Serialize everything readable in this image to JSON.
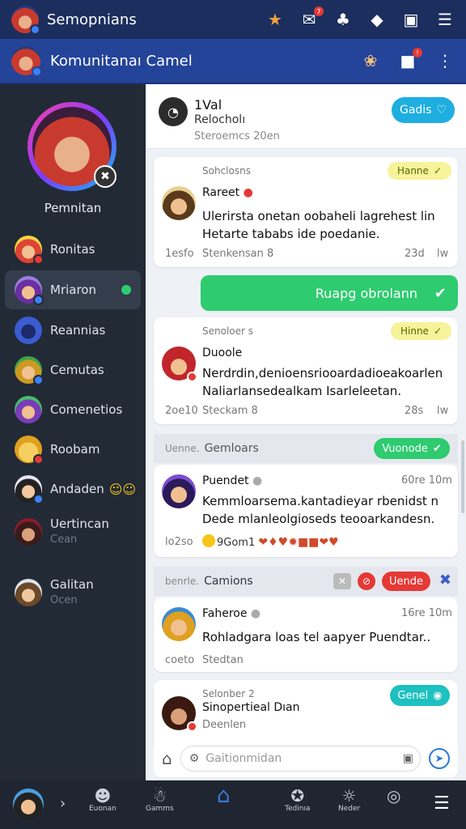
{
  "app": {
    "title": "Semopnians"
  },
  "community": {
    "title": "Komunitanaı Camel"
  },
  "sidebar": {
    "profile_name": "Pemnitan",
    "items": [
      {
        "label": "Ronitas",
        "sub": ""
      },
      {
        "label": "Mriaron",
        "sub": ""
      },
      {
        "label": "Reannias",
        "sub": ""
      },
      {
        "label": "Cemutas",
        "sub": ""
      },
      {
        "label": "Comenetios",
        "sub": ""
      },
      {
        "label": "Roobam",
        "sub": ""
      },
      {
        "label": "Andaden",
        "sub": ""
      },
      {
        "label": "Uertincan",
        "sub": "Cean"
      },
      {
        "label": "Galitan",
        "sub": "Ocen"
      }
    ]
  },
  "header": {
    "line1": "1Val",
    "line2": "Relocholı",
    "line3": "Steroemcs 20en",
    "button": "Gadis"
  },
  "posts": [
    {
      "category": "Sohclosns",
      "tag": "Hanne",
      "name": "Rareet",
      "body": "Ulerirsta onetan oobaheli lagrehest lin Hetarte tababs ide poedanie.",
      "time": "1esfo",
      "meta": "Stenkensan 8",
      "right_time": "23d",
      "right_meta": "lw"
    },
    {
      "category": "Senoloer s",
      "tag": "Hinne",
      "name": "Duoole",
      "body": "Nerdrdin,denioensriooardadioeakoarlen Naliarlansedealkam Isarleleetan.",
      "time": "2oe10",
      "meta": "Steckam 8",
      "right_time": "28s",
      "right_meta": "lw"
    },
    {
      "name": "Puendet",
      "time": "60re 10m",
      "body": "Kemmloarsema.kantadieyar rbenidst n Dede mlanleolgioseds teooarkandesn.",
      "meta": "9Gom1",
      "foot": "lo2so"
    },
    {
      "name": "Faheroe",
      "time": "16re 10m",
      "body": "Rohladgara loas tel aapyer Puendtar..",
      "meta": "Stedtan",
      "foot": "coeto"
    },
    {
      "cat": "Selonber 2",
      "name": "Sinopertieal Dıan",
      "sub": "Deenlen",
      "button": "Genel"
    }
  ],
  "green_button": "Ruapg obrolann",
  "sections": [
    {
      "prefix": "Uenne.",
      "title": "Gemloars",
      "button": "Vuonode"
    },
    {
      "prefix": "benrle.",
      "title": "Camions",
      "button": "Uende"
    }
  ],
  "composer": {
    "placeholder": "Gaitionmidan"
  },
  "bottom_nav": [
    {
      "label": "Euonan",
      "icon": "people-icon"
    },
    {
      "label": "Gamms",
      "icon": "group-icon"
    },
    {
      "label": "",
      "icon": "home-icon"
    },
    {
      "label": "Tedinıa",
      "icon": "reward-icon"
    },
    {
      "label": "Neder",
      "icon": "alert-icon"
    },
    {
      "label": "",
      "icon": "settings-icon"
    }
  ],
  "colors": {
    "topbar": "#1c2e5e",
    "subbar": "#24449a",
    "accent_teal": "#1eaee0",
    "green": "#2ecb6f",
    "red": "#e53935",
    "sidebar": "#222a36"
  }
}
